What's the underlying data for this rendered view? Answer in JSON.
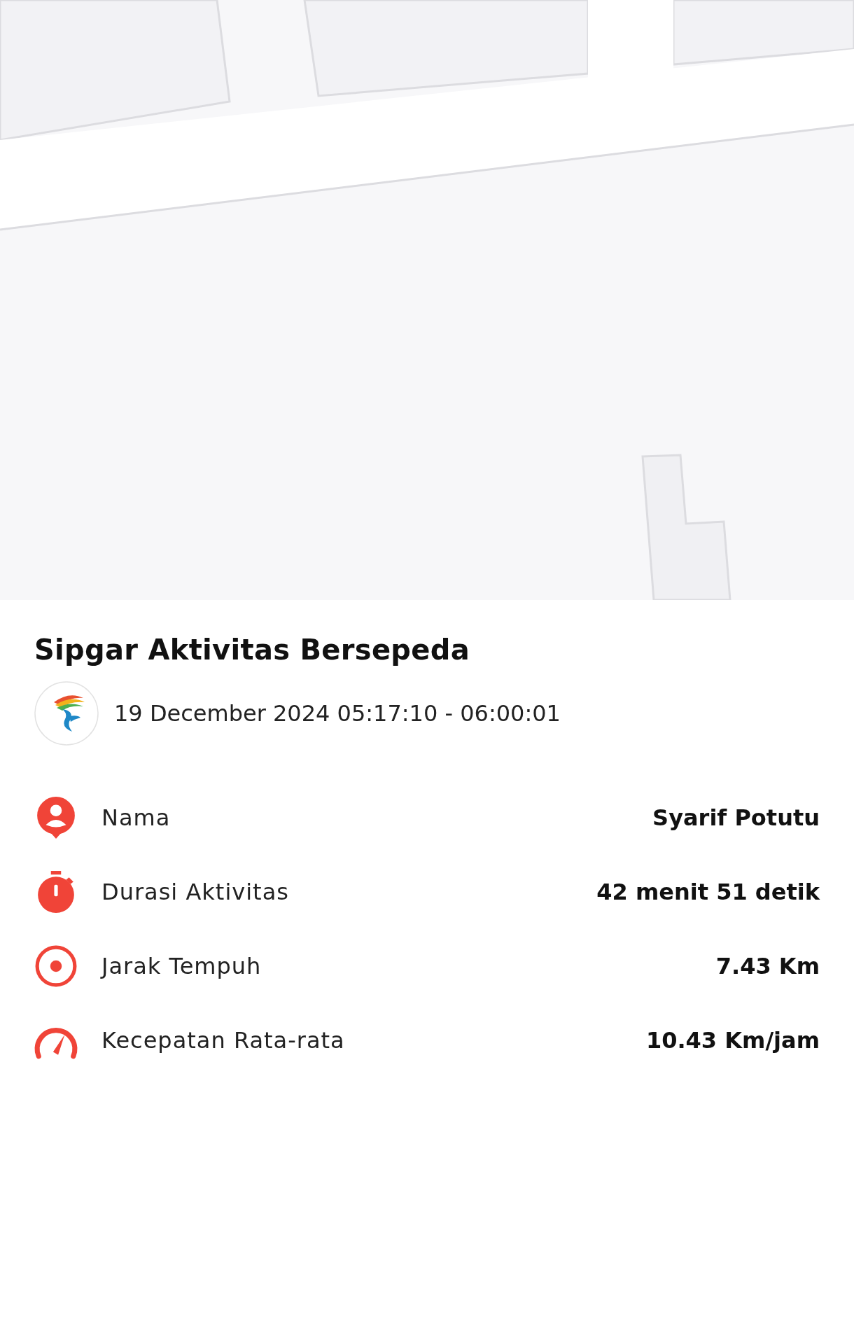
{
  "title": "Sipgar Aktivitas Bersepeda",
  "date_range": "19 December 2024 05:17:10 - 06:00:01",
  "stats": [
    {
      "kind": "person",
      "label": "Nama",
      "value": "Syarif Potutu"
    },
    {
      "kind": "timer",
      "label": "Durasi Aktivitas",
      "value": "42 menit 51 detik"
    },
    {
      "kind": "target",
      "label": "Jarak Tempuh",
      "value": "7.43 Km"
    },
    {
      "kind": "speed",
      "label": "Kecepatan Rata-rata",
      "value": "10.43 Km/jam"
    }
  ]
}
